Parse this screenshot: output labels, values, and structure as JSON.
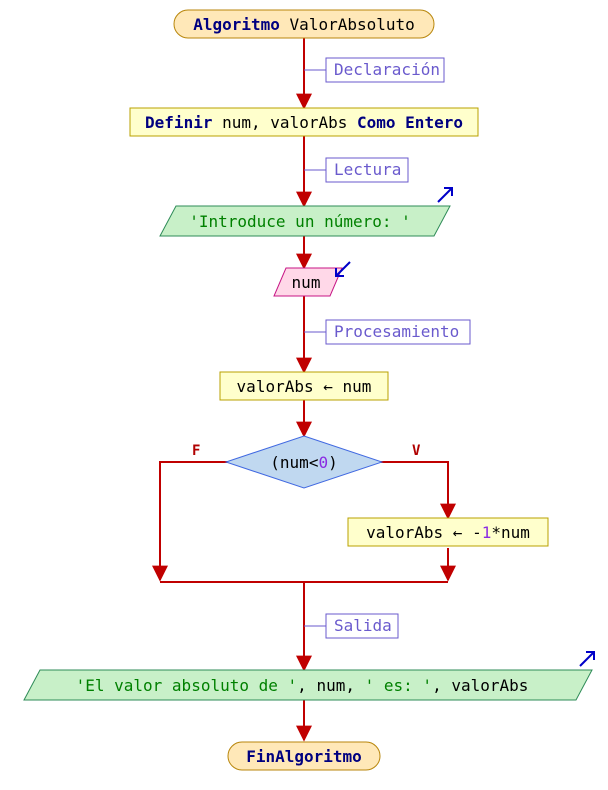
{
  "chart_data": {
    "type": "diagram",
    "title": "Algoritmo ValorAbsoluto",
    "nodes": [
      {
        "id": "start",
        "kind": "terminator",
        "tokens": [
          [
            "kw",
            "Algoritmo"
          ],
          [
            "sp",
            " "
          ],
          [
            "id",
            "ValorAbsoluto"
          ]
        ]
      },
      {
        "id": "declare",
        "kind": "process",
        "tokens": [
          [
            "kw",
            "Definir"
          ],
          [
            "sp",
            " "
          ],
          [
            "id",
            "num"
          ],
          [
            "op",
            ","
          ],
          [
            "sp",
            " "
          ],
          [
            "id",
            "valorAbs"
          ],
          [
            "sp",
            " "
          ],
          [
            "kw",
            "Como"
          ],
          [
            "sp",
            " "
          ],
          [
            "kw",
            "Entero"
          ]
        ]
      },
      {
        "id": "out1",
        "kind": "output",
        "tokens": [
          [
            "str",
            "'Introduce un número: '"
          ]
        ]
      },
      {
        "id": "in1",
        "kind": "input",
        "tokens": [
          [
            "id",
            "num"
          ]
        ]
      },
      {
        "id": "assign1",
        "kind": "process",
        "tokens": [
          [
            "id",
            "valorAbs"
          ],
          [
            "sp",
            " "
          ],
          [
            "op",
            "←"
          ],
          [
            "sp",
            " "
          ],
          [
            "id",
            "num"
          ]
        ]
      },
      {
        "id": "decision",
        "kind": "decision",
        "tokens": [
          [
            "op",
            "("
          ],
          [
            "id",
            "num"
          ],
          [
            "op",
            "<"
          ],
          [
            "num",
            "0"
          ],
          [
            "op",
            ")"
          ]
        ]
      },
      {
        "id": "assign2",
        "kind": "process",
        "tokens": [
          [
            "id",
            "valorAbs"
          ],
          [
            "sp",
            " "
          ],
          [
            "op",
            "←"
          ],
          [
            "sp",
            " "
          ],
          [
            "op",
            "-"
          ],
          [
            "num",
            "1"
          ],
          [
            "op",
            "*"
          ],
          [
            "id",
            "num"
          ]
        ]
      },
      {
        "id": "out2",
        "kind": "output",
        "tokens": [
          [
            "str",
            "'El valor absoluto de '"
          ],
          [
            "op",
            ","
          ],
          [
            "sp",
            " "
          ],
          [
            "id",
            "num"
          ],
          [
            "op",
            ","
          ],
          [
            "sp",
            " "
          ],
          [
            "str",
            "' es: '"
          ],
          [
            "op",
            ","
          ],
          [
            "sp",
            " "
          ],
          [
            "id",
            "valorAbs"
          ]
        ]
      },
      {
        "id": "end",
        "kind": "terminator",
        "tokens": [
          [
            "kw",
            "FinAlgoritmo"
          ]
        ]
      }
    ],
    "edges": [
      {
        "from": "start",
        "to": "declare",
        "label": "Declaración"
      },
      {
        "from": "declare",
        "to": "out1",
        "label": "Lectura"
      },
      {
        "from": "out1",
        "to": "in1",
        "label": ""
      },
      {
        "from": "in1",
        "to": "assign1",
        "label": "Procesamiento"
      },
      {
        "from": "assign1",
        "to": "decision",
        "label": ""
      },
      {
        "from": "decision",
        "to": "assign2",
        "label": "V"
      },
      {
        "from": "decision",
        "to": "merge",
        "label": "F"
      },
      {
        "from": "assign2",
        "to": "merge",
        "label": ""
      },
      {
        "from": "merge",
        "to": "out2",
        "label": "Salida"
      },
      {
        "from": "out2",
        "to": "end",
        "label": ""
      }
    ],
    "labels": {
      "decision_true": "V",
      "decision_false": "F",
      "stage_declare": "Declaración",
      "stage_read": "Lectura",
      "stage_process": "Procesamiento",
      "stage_output": "Salida"
    }
  }
}
